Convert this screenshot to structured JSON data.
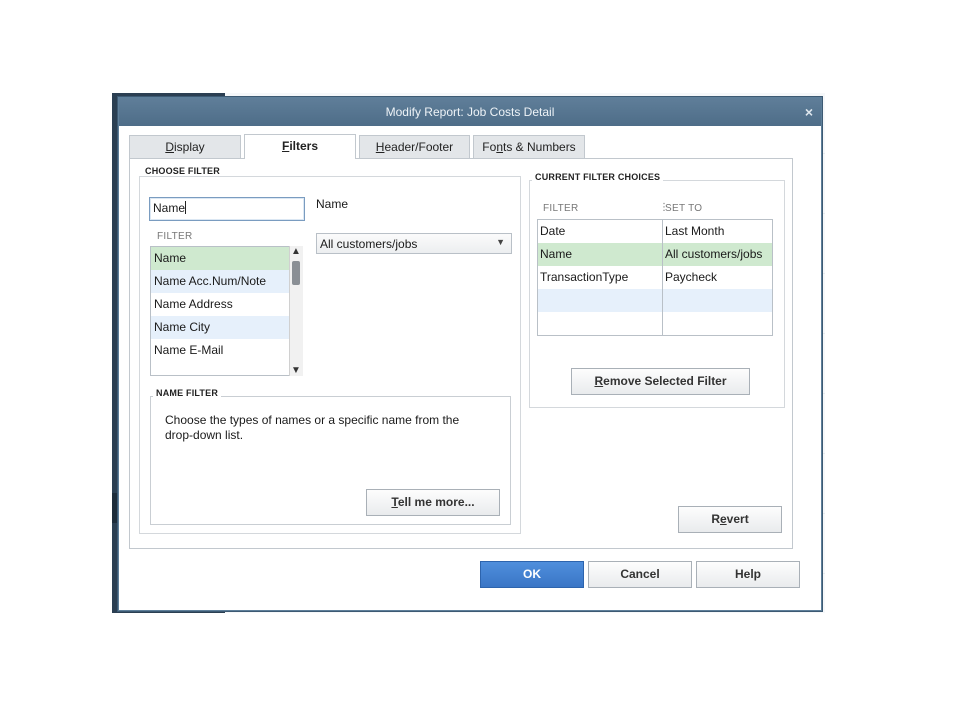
{
  "dialog": {
    "title": "Modify Report: Job Costs Detail",
    "close_glyph": "×"
  },
  "tabs": [
    {
      "prefix": "",
      "ul": "D",
      "suffix": "isplay",
      "active": false
    },
    {
      "prefix": "",
      "ul": "F",
      "suffix": "ilters",
      "active": true
    },
    {
      "prefix": "",
      "ul": "H",
      "suffix": "eader/Footer",
      "active": false
    },
    {
      "prefix": "Fo",
      "ul": "n",
      "suffix": "ts & Numbers",
      "active": false
    }
  ],
  "choose_filter": {
    "section_label": "CHOOSE FILTER",
    "search_value": "Name",
    "filter_col_label": "FILTER",
    "list": [
      "Name",
      "Name Acc.Num/Note",
      "Name Address",
      "Name City",
      "Name E-Mail"
    ],
    "selected_index": 0,
    "detail_label": "Name",
    "dropdown_value": "All customers/jobs",
    "dropdown_arrow": "▼",
    "scroll_up": "▲",
    "scroll_down": "▼"
  },
  "name_filter": {
    "section_label": "NAME FILTER",
    "description": "Choose the types of names or a specific name from the drop-down list.",
    "tell_more_ul": "T",
    "tell_more_rest": "ell me more..."
  },
  "current_filters": {
    "section_label": "CURRENT FILTER CHOICES",
    "col_filter": "FILTER",
    "col_set_to": "SET TO",
    "col_sep": "⋮",
    "rows": [
      {
        "filter": "Date",
        "set_to": "Last Month"
      },
      {
        "filter": "Name",
        "set_to": "All customers/jobs"
      },
      {
        "filter": "TransactionType",
        "set_to": "Paycheck"
      }
    ],
    "selected_index": 1,
    "remove_ul": "R",
    "remove_rest": "emove Selected Filter"
  },
  "revert": {
    "prefix": "R",
    "ul": "e",
    "suffix": "vert"
  },
  "footer": {
    "ok": "OK",
    "cancel": "Cancel",
    "help": "Help"
  },
  "colors": {
    "titlebar": "#5f7e99",
    "selected_row": "#cfe9cf",
    "alt_row": "#e6f0fb",
    "ok_button": "#3a76c6"
  }
}
